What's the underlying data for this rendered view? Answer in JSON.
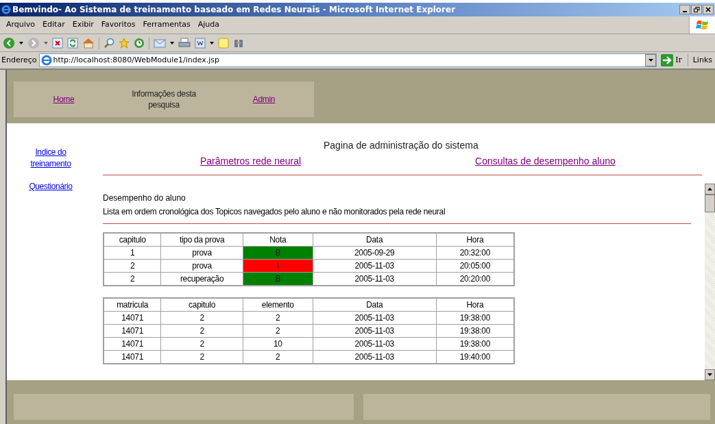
{
  "window": {
    "title": "Bemvindo- Ao Sistema de treinamento baseado em Redes Neurais - Microsoft Internet Explorer"
  },
  "menu": [
    "Arquivo",
    "Editar",
    "Exibir",
    "Favoritos",
    "Ferramentas",
    "Ajuda"
  ],
  "address_bar": {
    "label": "Endereço",
    "url": "http://localhost:8080/WebModule1/index.jsp",
    "go": "Ir",
    "links": "Links"
  },
  "header_nav": [
    {
      "kind": "link",
      "text": "Home",
      "visited": true
    },
    {
      "kind": "text",
      "text": "Informações desta pesquisa"
    },
    {
      "kind": "link",
      "text": "Admin",
      "visited": true
    }
  ],
  "sidebar": [
    {
      "text": "Indice do treinamento",
      "visited": false
    },
    {
      "text": "Questionário",
      "visited": false
    }
  ],
  "page_title": "Pagina de administração do sistema",
  "admin_links": [
    {
      "text": "Parâmetros rede neural",
      "visited": true
    },
    {
      "text": "Consultas de desempenho aluno",
      "visited": true
    }
  ],
  "section": {
    "heading": "Desempenho do aluno",
    "description": "Lista em ordem cronológica dos Topicos navegados pelo aluno e não monitorados pela rede neural"
  },
  "tests_table": {
    "columns": [
      "capitulo",
      "tipo da prova",
      "Nota",
      "Data",
      "Hora"
    ],
    "rows": [
      {
        "capitulo": "1",
        "tipo": "prova",
        "nota": "B",
        "color": "#008000",
        "data": "2005-09-29",
        "hora": "20:32:00"
      },
      {
        "capitulo": "2",
        "tipo": "prova",
        "nota": "I",
        "color": "#ff0000",
        "data": "2005-11-03",
        "hora": "20:05:00"
      },
      {
        "capitulo": "2",
        "tipo": "recuperação",
        "nota": "B",
        "color": "#008000",
        "data": "2005-11-03",
        "hora": "20:20:00"
      }
    ]
  },
  "topics_table": {
    "columns": [
      "matricula",
      "capitulo",
      "elemento",
      "Data",
      "Hora"
    ],
    "rows": [
      [
        "14071",
        "2",
        "2",
        "2005-11-03",
        "19:38:00"
      ],
      [
        "14071",
        "2",
        "2",
        "2005-11-03",
        "19:38:00"
      ],
      [
        "14071",
        "2",
        "10",
        "2005-11-03",
        "19:38:00"
      ],
      [
        "14071",
        "2",
        "2",
        "2005-11-03",
        "19:40:00"
      ]
    ]
  }
}
